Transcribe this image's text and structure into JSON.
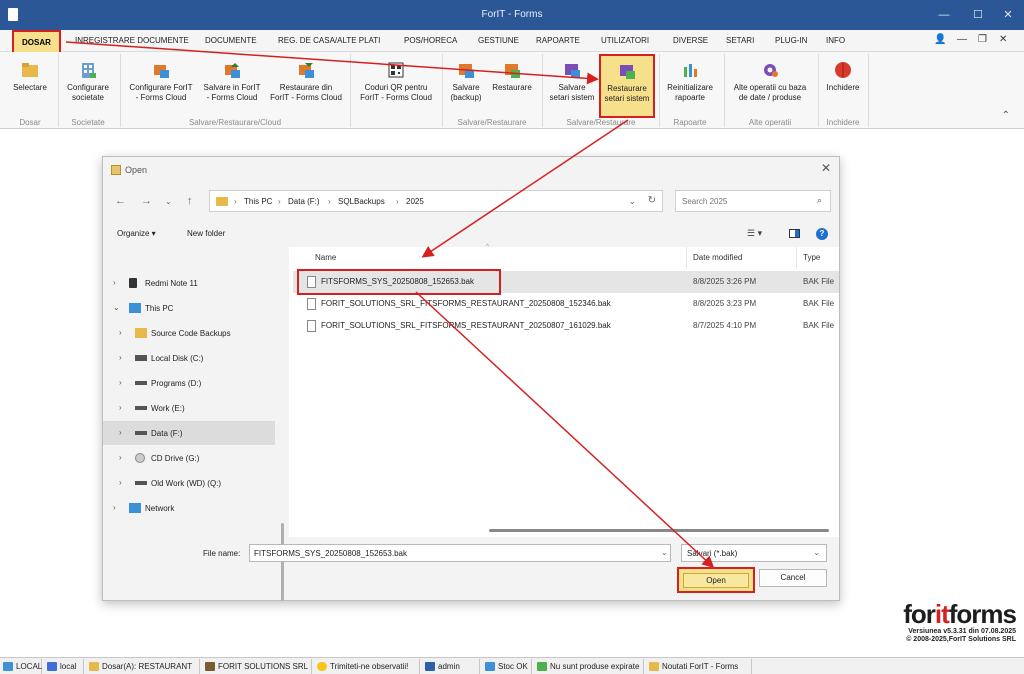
{
  "window": {
    "title": "ForIT - Forms"
  },
  "menu": {
    "items": [
      "DOSAR",
      "INREGISTRARE DOCUMENTE",
      "DOCUMENTE",
      "REG. DE CASA/ALTE PLATI",
      "POS/HORECA",
      "GESTIUNE",
      "RAPOARTE",
      "UTILIZATORI",
      "DIVERSE",
      "SETARI",
      "PLUG-IN",
      "INFO"
    ],
    "active": "DOSAR"
  },
  "ribbon": {
    "buttons": [
      {
        "l1": "Selectare",
        "l2": ""
      },
      {
        "l1": "Configurare",
        "l2": "societate"
      },
      {
        "l1": "Configurare ForIT",
        "l2": "- Forms Cloud"
      },
      {
        "l1": "Salvare in ForIT",
        "l2": "- Forms Cloud"
      },
      {
        "l1": "Restaurare din",
        "l2": "ForIT - Forms Cloud"
      },
      {
        "l1": "Coduri QR pentru",
        "l2": "ForIT - Forms Cloud"
      },
      {
        "l1": "Salvare",
        "l2": "(backup)"
      },
      {
        "l1": "Restaurare",
        "l2": ""
      },
      {
        "l1": "Salvare",
        "l2": "setari sistem"
      },
      {
        "l1": "Restaurare",
        "l2": "setari sistem"
      },
      {
        "l1": "Reinitializare",
        "l2": "rapoarte"
      },
      {
        "l1": "Alte operatii cu baza",
        "l2": "de date / produse"
      },
      {
        "l1": "Inchidere",
        "l2": ""
      }
    ],
    "groups": [
      "Dosar",
      "Societate",
      "Salvare/Restaurare/Cloud",
      "Salvare/Restaurare",
      "Salvare/Restaurare",
      "Rapoarte",
      "Alte operatii",
      "Inchidere"
    ]
  },
  "dialog": {
    "title": "Open",
    "breadcrumb": [
      "This PC",
      "Data (F:)",
      "SQLBackups",
      "2025"
    ],
    "search_placeholder": "Search 2025",
    "organize": "Organize ▾",
    "new_folder": "New folder",
    "nav": [
      {
        "label": "Redmi Note 11",
        "icon": "phone-icon"
      },
      {
        "label": "This PC",
        "icon": "pc-icon"
      },
      {
        "label": "Source Code Backups",
        "icon": "folder-icon"
      },
      {
        "label": "Local Disk (C:)",
        "icon": "drive-icon"
      },
      {
        "label": "Programs (D:)",
        "icon": "drive-icon"
      },
      {
        "label": "Work (E:)",
        "icon": "drive-icon"
      },
      {
        "label": "Data (F:)",
        "icon": "drive-icon"
      },
      {
        "label": "CD Drive (G:)",
        "icon": "cd-icon"
      },
      {
        "label": "Old Work (WD) (Q:)",
        "icon": "drive-icon"
      },
      {
        "label": "Network",
        "icon": "network-icon"
      }
    ],
    "columns": [
      "Name",
      "Date modified",
      "Type"
    ],
    "files": [
      {
        "name": "FITSFORMS_SYS_20250808_152653.bak",
        "date": "8/8/2025 3:26 PM",
        "type": "BAK File"
      },
      {
        "name": "FORIT_SOLUTIONS_SRL_FITSFORMS_RESTAURANT_20250808_152346.bak",
        "date": "8/8/2025 3:23 PM",
        "type": "BAK File"
      },
      {
        "name": "FORIT_SOLUTIONS_SRL_FITSFORMS_RESTAURANT_20250807_161029.bak",
        "date": "8/7/2025 4:10 PM",
        "type": "BAK File"
      }
    ],
    "file_name_label": "File name:",
    "file_name_value": "FITSFORMS_SYS_20250808_152653.bak",
    "filter": "Salvari (*.bak)",
    "open": "Open",
    "cancel": "Cancel"
  },
  "logo": {
    "a": "for",
    "b": "it",
    "c": "forms",
    "version": "Versiunea v5.3.31 din 07.08.2025",
    "copyright": "© 2008-2025,ForIT Solutions SRL"
  },
  "status": [
    "LOCAL",
    "local",
    "Dosar(A): RESTAURANT",
    "FORIT SOLUTIONS SRL",
    "Trimiteti-ne observatii!",
    "admin",
    "Stoc OK",
    "Nu sunt produse expirate",
    "Noutati ForIT - Forms"
  ],
  "colors": {
    "titlebar": "#2b5797",
    "highlight": "#f6e08c",
    "annotation_red": "#d62020"
  }
}
